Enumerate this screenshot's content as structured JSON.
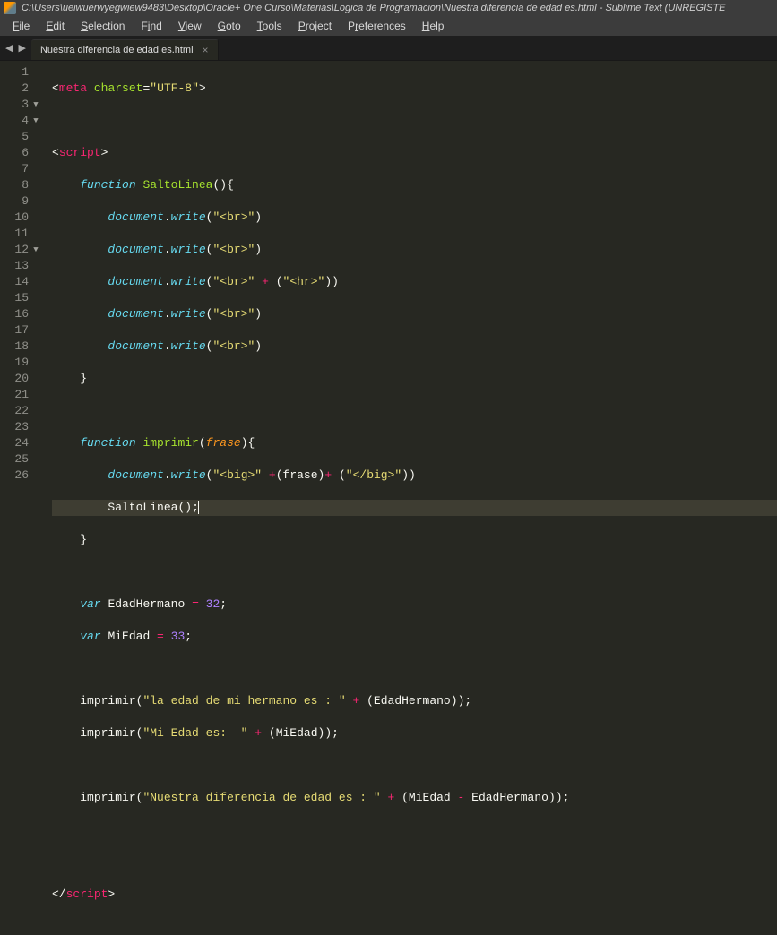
{
  "title": "C:\\Users\\ueiwuerwyegwiew9483\\Desktop\\Oracle+ One Curso\\Materias\\Logica de Programacion\\Nuestra diferencia de edad es.html - Sublime Text (UNREGISTE",
  "menu": {
    "file": "File",
    "edit": "Edit",
    "selection": "Selection",
    "find": "Find",
    "view": "View",
    "goto": "Goto",
    "tools": "Tools",
    "project": "Project",
    "preferences": "Preferences",
    "help": "Help"
  },
  "tab": {
    "name": "Nuestra diferencia de edad es.html",
    "close": "×"
  },
  "nav": {
    "back": "◀",
    "fwd": "▶"
  },
  "ln": {
    "1": "1",
    "2": "2",
    "3": "3",
    "4": "4",
    "5": "5",
    "6": "6",
    "7": "7",
    "8": "8",
    "9": "9",
    "10": "10",
    "11": "11",
    "12": "12",
    "13": "13",
    "14": "14",
    "15": "15",
    "16": "16",
    "17": "17",
    "18": "18",
    "19": "19",
    "20": "20",
    "21": "21",
    "22": "22",
    "23": "23",
    "24": "24",
    "25": "25",
    "26": "26"
  },
  "code": {
    "meta_open": "<",
    "meta_tag": "meta",
    "meta_sp": " ",
    "charset_attr": "charset",
    "eq": "=",
    "utf8": "\"UTF-8\"",
    "tag_close": ">",
    "script_open_lt": "<",
    "script_tag": "script",
    "func_kw": "function",
    "salto_name": "SaltoLinea",
    "paren_open": "(",
    "paren_close": ")",
    "brace_open": "{",
    "brace_close": "}",
    "document": "document",
    "dot": ".",
    "write": "write",
    "br_str": "\"<br>\"",
    "hr_str": "\"<hr>\"",
    "plus": " + ",
    "imprimir_name": "imprimir",
    "frase_param": "frase",
    "big_open": "\"<big>\" ",
    "plus_op": "+",
    "big_close": "\"</big>\"",
    "salto_call": "SaltoLinea",
    "semi": ";",
    "var_kw": "var",
    "edad_h": "EdadHermano",
    "assign": " = ",
    "n32": "32",
    "miedad": "MiEdad",
    "n33": "33",
    "str_herm": "\"la edad de mi hermano es : \"",
    "str_miedad": "\"Mi Edad es:  \"",
    "str_diff": "\"Nuestra diferencia de edad es : \"",
    "minus": " - ",
    "script_close_lt": "</",
    "indent1": "    ",
    "indent2": "        ",
    "indent3": "            "
  }
}
